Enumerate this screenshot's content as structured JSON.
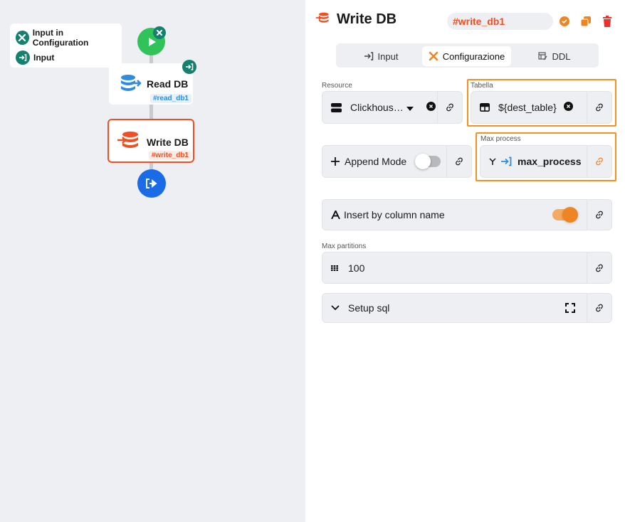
{
  "canvas": {
    "legend": [
      {
        "icon": "tools-icon",
        "label": "Input in Configuration"
      },
      {
        "icon": "input-icon",
        "label": "Input"
      }
    ],
    "nodes": {
      "read": {
        "title": "Read DB",
        "tag": "#read_db1"
      },
      "write": {
        "title": "Write DB",
        "tag": "#write_db1"
      }
    }
  },
  "panel": {
    "title": "Write DB",
    "node_id": "#write_db1",
    "tabs": [
      {
        "label": "Input",
        "active": false
      },
      {
        "label": "Configurazione",
        "active": true
      },
      {
        "label": "DDL",
        "active": false
      }
    ],
    "fields": {
      "resource": {
        "label": "Resource",
        "value": "Clickhous…"
      },
      "tabella": {
        "label": "Tabella",
        "value": "${dest_table}"
      },
      "append_mode": {
        "label": "Append Mode",
        "enabled": false
      },
      "max_process": {
        "label": "Max process",
        "value": "max_process"
      },
      "insert_by_column": {
        "label": "Insert by column name",
        "enabled": true
      },
      "max_partitions": {
        "label": "Max partitions",
        "value": "100"
      },
      "setup_sql": {
        "label": "Setup sql"
      }
    }
  },
  "colors": {
    "accent_orange": "#f04e23",
    "highlight": "#f39222",
    "toggle_on": "#ee8522",
    "teal_badge": "#15806e",
    "start_green": "#2fc35a",
    "end_blue": "#1a6be8",
    "delete_red": "#f0302a"
  }
}
